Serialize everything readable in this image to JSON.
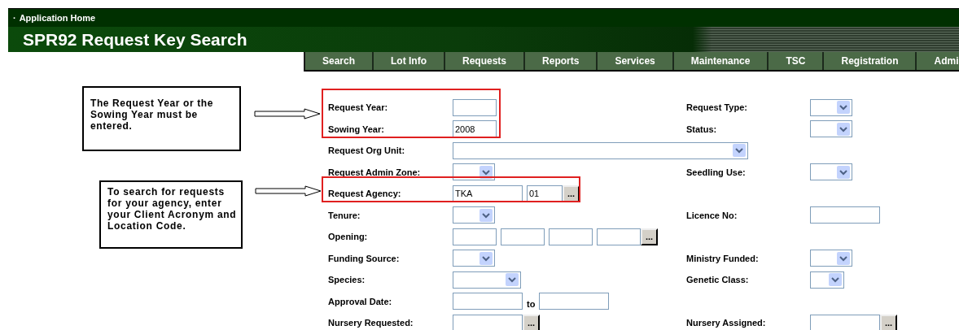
{
  "header": {
    "bullet": "·",
    "breadcrumb": "Application Home",
    "title": "SPR92 Request Key Search"
  },
  "tabs": [
    {
      "label": "Search"
    },
    {
      "label": "Lot Info"
    },
    {
      "label": "Requests"
    },
    {
      "label": "Reports"
    },
    {
      "label": "Services"
    },
    {
      "label": "Maintenance"
    },
    {
      "label": "TSC"
    },
    {
      "label": "Registration"
    },
    {
      "label": "Admi"
    }
  ],
  "form": {
    "rows": [
      {
        "left": {
          "label": "Request Year:",
          "controls": [
            {
              "kind": "text"
            }
          ]
        },
        "right": {
          "label": "Request Type:",
          "controls": [
            {
              "kind": "select"
            }
          ]
        }
      },
      {
        "left": {
          "label": "Sowing Year:",
          "controls": [
            {
              "kind": "text",
              "value": "2008"
            }
          ]
        },
        "right": {
          "label": "Status:",
          "controls": [
            {
              "kind": "select"
            }
          ]
        }
      },
      {
        "left": {
          "label": "Request Org Unit:",
          "controls": [
            {
              "kind": "select-wide"
            }
          ]
        }
      },
      {
        "left": {
          "label": "Request Admin Zone:",
          "controls": [
            {
              "kind": "select"
            }
          ]
        },
        "right": {
          "label": "Seedling Use:",
          "controls": [
            {
              "kind": "select"
            }
          ]
        }
      },
      {
        "left": {
          "label": "Request Agency:",
          "controls": [
            {
              "kind": "text-long",
              "value": "TKA"
            },
            {
              "kind": "text-short",
              "value": "01"
            },
            {
              "kind": "lookup",
              "label": "..."
            }
          ]
        }
      },
      {
        "left": {
          "label": "Tenure:",
          "controls": [
            {
              "kind": "select"
            }
          ]
        },
        "right": {
          "label": "Licence No:",
          "controls": [
            {
              "kind": "text-long"
            }
          ]
        }
      },
      {
        "left": {
          "label": "Opening:",
          "controls": [
            {
              "kind": "text"
            },
            {
              "kind": "text"
            },
            {
              "kind": "text"
            },
            {
              "kind": "text"
            },
            {
              "kind": "lookup",
              "label": "..."
            }
          ]
        }
      },
      {
        "left": {
          "label": "Funding Source:",
          "controls": [
            {
              "kind": "select"
            }
          ]
        },
        "right": {
          "label": "Ministry Funded:",
          "controls": [
            {
              "kind": "select"
            }
          ]
        }
      },
      {
        "left": {
          "label": "Species:",
          "controls": [
            {
              "kind": "select-long"
            }
          ]
        },
        "right": {
          "label": "Genetic Class:",
          "controls": [
            {
              "kind": "select-short"
            }
          ]
        }
      },
      {
        "left": {
          "label": "Approval Date:",
          "controls": [
            {
              "kind": "text-long"
            },
            {
              "kind": "word",
              "text": "to"
            },
            {
              "kind": "text-long"
            }
          ]
        }
      },
      {
        "left": {
          "label": "Nursery Requested:",
          "controls": [
            {
              "kind": "text-long"
            },
            {
              "kind": "lookup",
              "label": "..."
            }
          ]
        },
        "right": {
          "label": "Nursery Assigned:",
          "controls": [
            {
              "kind": "text-long"
            },
            {
              "kind": "lookup",
              "label": "..."
            }
          ]
        }
      }
    ]
  },
  "notes": [
    {
      "text": "The Request Year or the Sowing Year must be entered."
    },
    {
      "text": "To search for requests for your agency, enter your Client Acronym and Location Code."
    }
  ]
}
